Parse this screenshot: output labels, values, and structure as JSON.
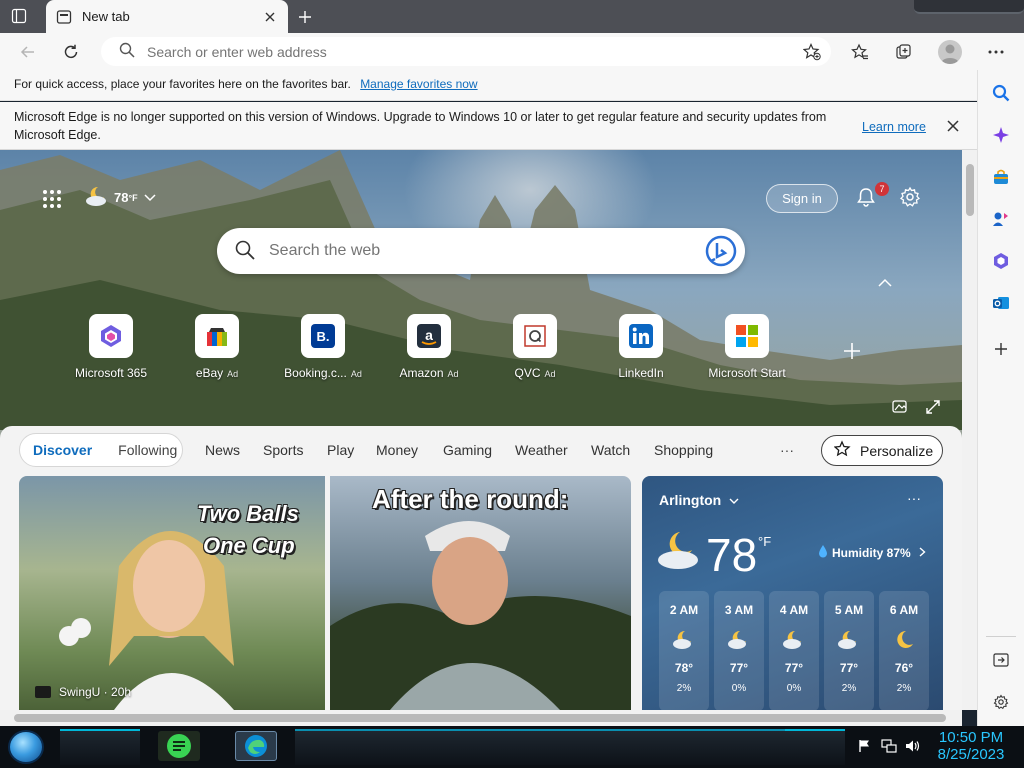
{
  "browser": {
    "tab_title": "New tab",
    "address_placeholder": "Search or enter web address"
  },
  "favbar": {
    "text": "For quick access, place your favorites here on the favorites bar.",
    "link": "Manage favorites now"
  },
  "infobar": {
    "text": "Microsoft Edge is no longer supported on this version of Windows. Upgrade to Windows 10 or later to get regular feature and security updates from Microsoft Edge.",
    "learn_more": "Learn more"
  },
  "ntp": {
    "weather_temp": "78",
    "weather_unit": "°F",
    "sign_in": "Sign in",
    "notification_count": "7",
    "search_placeholder": "Search the web"
  },
  "quick_links": [
    {
      "label": "Microsoft 365",
      "ad": ""
    },
    {
      "label": "eBay",
      "ad": "Ad"
    },
    {
      "label": "Booking.c...",
      "ad": "Ad"
    },
    {
      "label": "Amazon",
      "ad": "Ad"
    },
    {
      "label": "QVC",
      "ad": "Ad"
    },
    {
      "label": "LinkedIn",
      "ad": ""
    },
    {
      "label": "Microsoft Start",
      "ad": ""
    }
  ],
  "feed": {
    "tabs": [
      "Discover",
      "Following"
    ],
    "nav": [
      "News",
      "Sports",
      "Play",
      "Money",
      "Gaming",
      "Weather",
      "Watch",
      "Shopping"
    ],
    "more": "···",
    "personalize": "Personalize",
    "card1": {
      "headline_line1": "Two Balls",
      "headline_line2": "One Cup",
      "source": "SwingU · 20h"
    },
    "card2": {
      "headline": "After the round:"
    }
  },
  "weather_card": {
    "location": "Arlington",
    "temp": "78",
    "unit": "°F",
    "humidity": "Humidity 87%",
    "hours": [
      {
        "time": "2 AM",
        "temp": "78°",
        "precip": "2%"
      },
      {
        "time": "3 AM",
        "temp": "77°",
        "precip": "0%"
      },
      {
        "time": "4 AM",
        "temp": "77°",
        "precip": "0%"
      },
      {
        "time": "5 AM",
        "temp": "77°",
        "precip": "2%"
      },
      {
        "time": "6 AM",
        "temp": "76°",
        "precip": "2%"
      }
    ]
  },
  "taskbar": {
    "time": "10:50 PM",
    "date": "8/25/2023"
  },
  "colors": {
    "accent": "#0f6cbd",
    "clock": "#29c7ff"
  }
}
